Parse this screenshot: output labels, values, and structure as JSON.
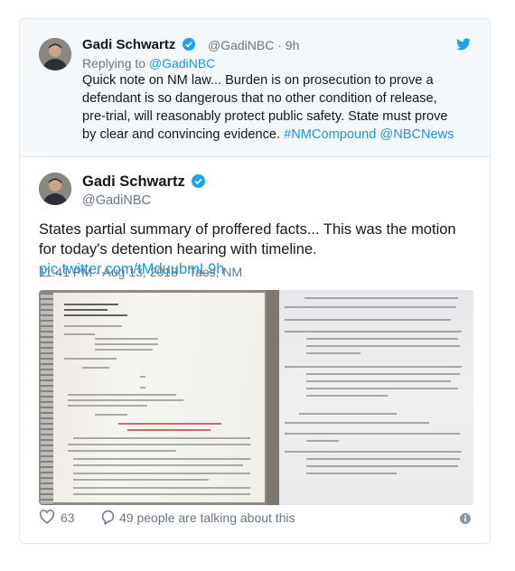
{
  "reply_tweet": {
    "name": "Gadi Schwartz",
    "handle": "@GadiNBC",
    "separator": "·",
    "time": "9h",
    "replying_prefix": "Replying to",
    "replying_to": "@GadiNBC",
    "text": "Quick note on NM law... Burden is on prosecution to prove a defendant is so dangerous that no other condition of release, pre-trial, will reasonably protect public safety. State must prove by clear and convincing evidence.",
    "hashtag": "#NMCompound",
    "mention": "@NBCNews"
  },
  "main_tweet": {
    "name": "Gadi Schwartz",
    "handle": "@GadiNBC",
    "text": "States partial summary of proffered facts... This was the motion for today's detention hearing with timeline.",
    "link": "pic.twitter.com/tMduubmL9h",
    "timestamp": "11:41 PM - Aug 13, 2018 · Taos, NM"
  },
  "footer": {
    "likes": "63",
    "talking": "49 people are talking about this"
  },
  "colors": {
    "link": "#1b95e0",
    "verified": "#1da1f2",
    "muted": "#657786"
  },
  "icons": [
    "verified-badge-icon",
    "twitter-bird-icon",
    "heart-icon",
    "speech-bubble-icon",
    "info-icon"
  ]
}
